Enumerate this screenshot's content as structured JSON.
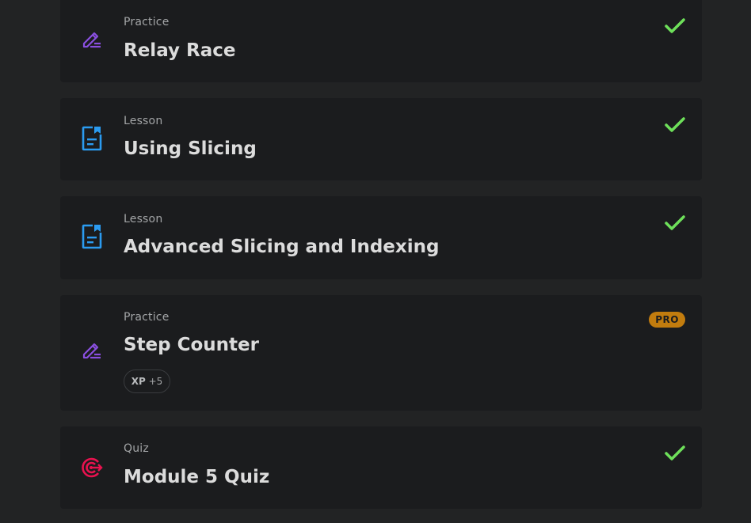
{
  "items": [
    {
      "type": "Practice",
      "title": "Relay Race",
      "icon": "pencil-practice-icon",
      "status": "completed"
    },
    {
      "type": "Lesson",
      "title": "Using Slicing",
      "icon": "lesson-document-icon",
      "status": "completed"
    },
    {
      "type": "Lesson",
      "title": "Advanced Slicing and Indexing",
      "icon": "lesson-document-icon",
      "status": "completed"
    },
    {
      "type": "Practice",
      "title": "Step Counter",
      "icon": "pencil-practice-icon",
      "status": "locked",
      "badge": "PRO",
      "xp_label": "XP",
      "xp_value": "+5"
    },
    {
      "type": "Quiz",
      "title": "Module 5 Quiz",
      "icon": "target-quiz-icon",
      "status": "completed"
    }
  ],
  "colors": {
    "background": "#222324",
    "card": "#1b1c1e",
    "check": "#6ee05a",
    "practice_icon": "#8a4fe0",
    "lesson_icon": "#2b9bf0",
    "quiz_icon": "#e8124f",
    "pro_badge": "#c27c0e"
  }
}
